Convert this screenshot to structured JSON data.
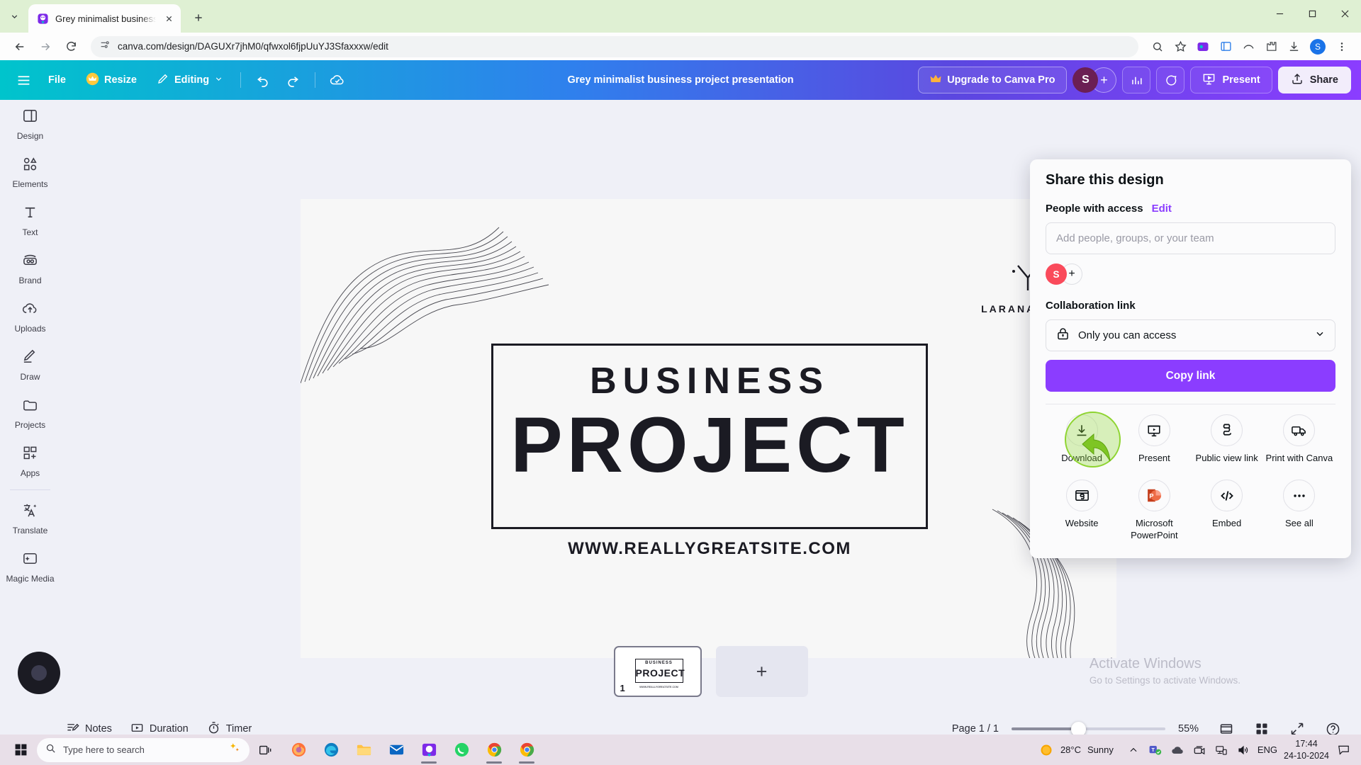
{
  "browser": {
    "tab": {
      "title": "Grey minimalist business projec",
      "favicon": "canva-favicon",
      "close": "×"
    },
    "new_tab_label": "+",
    "url": "canva.com/design/DAGUXr7jhM0/qfwxol6fjpUuYJ3Sfaxxxw/edit",
    "profile_initial": "S",
    "window_controls": {
      "minimize": "—",
      "maximize": "▢",
      "close": "✕"
    }
  },
  "toolbar": {
    "menu": "hamburger-menu",
    "file": "File",
    "resize": "Resize",
    "editing": "Editing",
    "doc_title": "Grey minimalist business project presentation",
    "upgrade": "Upgrade to Canva Pro",
    "avatar_initial": "S",
    "add_collaborator": "+",
    "present": "Present",
    "share": "Share"
  },
  "sidebar": {
    "items": [
      {
        "label": "Design",
        "icon": "design-icon"
      },
      {
        "label": "Elements",
        "icon": "elements-icon"
      },
      {
        "label": "Text",
        "icon": "text-icon"
      },
      {
        "label": "Brand",
        "icon": "brand-icon"
      },
      {
        "label": "Uploads",
        "icon": "uploads-icon"
      },
      {
        "label": "Draw",
        "icon": "draw-icon"
      },
      {
        "label": "Projects",
        "icon": "projects-icon"
      },
      {
        "label": "Apps",
        "icon": "apps-icon"
      }
    ],
    "bottom_items": [
      {
        "label": "Translate",
        "icon": "translate-icon"
      },
      {
        "label": "Magic Media",
        "icon": "magic-media-icon"
      }
    ]
  },
  "slide": {
    "title_small": "BUSINESS",
    "title_large": "PROJECT",
    "website": "WWW.REALLYGREATSITE.COM",
    "brand_name": "LARANA, INC."
  },
  "pages": {
    "thumb_number": "1",
    "thumb_business": "BUSINESS",
    "thumb_project": "PROJECT",
    "thumb_url": "WWW.REALLYGREATSITE.COM",
    "add_page": "+"
  },
  "bottom_bar": {
    "notes": "Notes",
    "duration": "Duration",
    "timer": "Timer",
    "page_label": "Page 1 / 1",
    "zoom": "55%",
    "icons": [
      "fit-page-icon",
      "grid-view-icon",
      "fullscreen-icon",
      "help-icon"
    ]
  },
  "share_panel": {
    "title": "Share this design",
    "people_label": "People with access",
    "edit_link": "Edit",
    "input_placeholder": "Add people, groups, or your team",
    "avatar_initial": "S",
    "add_person": "+",
    "collab_label": "Collaboration link",
    "access_value": "Only you can access",
    "copy_link": "Copy link",
    "options": [
      {
        "label": "Download",
        "icon": "download-icon",
        "highlighted": true
      },
      {
        "label": "Present",
        "icon": "present-icon",
        "highlighted": false
      },
      {
        "label": "Public view link",
        "icon": "link-icon",
        "highlighted": false
      },
      {
        "label": "Print with Canva",
        "icon": "truck-icon",
        "highlighted": false
      },
      {
        "label": "Website",
        "icon": "website-icon",
        "highlighted": false
      },
      {
        "label": "Microsoft PowerPoint",
        "icon": "powerpoint-icon",
        "highlighted": false
      },
      {
        "label": "Embed",
        "icon": "embed-icon",
        "highlighted": false
      },
      {
        "label": "See all",
        "icon": "ellipsis-icon",
        "highlighted": false
      }
    ]
  },
  "watermark": {
    "line1": "Activate Windows",
    "line2": "Go to Settings to activate Windows."
  },
  "taskbar": {
    "search_placeholder": "Type here to search",
    "weather_temp": "28°C",
    "weather_desc": "Sunny",
    "language": "ENG",
    "time": "17:44",
    "date": "24-10-2024"
  },
  "colors": {
    "canva_purple": "#8b3dff",
    "canva_teal": "#00c4cc",
    "avatar_red": "#fa4a5b",
    "highlight_green": "#8ed430"
  }
}
